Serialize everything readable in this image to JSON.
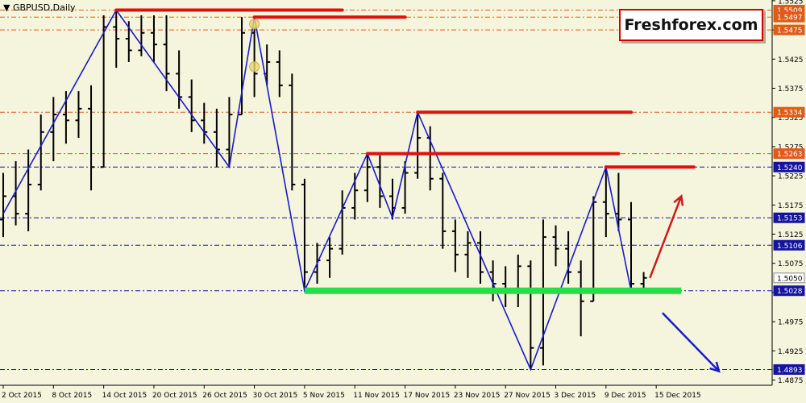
{
  "header": {
    "title": "GBPUSD,Daily",
    "title_arrow": "▼"
  },
  "brand": {
    "label": "Freshforex.com"
  },
  "colors": {
    "background": "#f5f4dc",
    "bars": "#000000",
    "zigzag": "#1a1acc",
    "resistance": "#e01010",
    "support": "#22e04a",
    "level_line": "#1010aa",
    "red_tag": "#e05a18",
    "blue_tag": "#1414a0",
    "white_tag": "#ffffff",
    "up_arrow": "#cc1a1a",
    "down_arrow": "#1a1acc"
  },
  "chart_data": {
    "type": "ohlc",
    "symbol": "GBPUSD",
    "timeframe": "Daily",
    "title": "GBPUSD,Daily",
    "ylim": [
      1.4866,
      1.5518
    ],
    "y_ticks": [
      "1.5525",
      "1.5475",
      "1.5425",
      "1.5375",
      "1.5325",
      "1.5275",
      "1.5225",
      "1.5175",
      "1.5125",
      "1.5075",
      "1.5025",
      "1.4975",
      "1.4925",
      "1.4875"
    ],
    "x_ticks": [
      {
        "label": "2 Oct 2015",
        "index": 0
      },
      {
        "label": "8 Oct 2015",
        "index": 4
      },
      {
        "label": "14 Oct 2015",
        "index": 8
      },
      {
        "label": "20 Oct 2015",
        "index": 12
      },
      {
        "label": "26 Oct 2015",
        "index": 16
      },
      {
        "label": "30 Oct 2015",
        "index": 20
      },
      {
        "label": "5 Nov 2015",
        "index": 24
      },
      {
        "label": "11 Nov 2015",
        "index": 28
      },
      {
        "label": "17 Nov 2015",
        "index": 32
      },
      {
        "label": "23 Nov 2015",
        "index": 36
      },
      {
        "label": "27 Nov 2015",
        "index": 40
      },
      {
        "label": "3 Dec 2015",
        "index": 44
      },
      {
        "label": "9 Dec 2015",
        "index": 48
      },
      {
        "label": "15 Dec 2015",
        "index": 52
      }
    ],
    "bars": [
      {
        "i": 0,
        "o": 1.515,
        "h": 1.523,
        "l": 1.512,
        "c": 1.519
      },
      {
        "i": 1,
        "o": 1.519,
        "h": 1.525,
        "l": 1.514,
        "c": 1.516
      },
      {
        "i": 2,
        "o": 1.516,
        "h": 1.527,
        "l": 1.513,
        "c": 1.521
      },
      {
        "i": 3,
        "o": 1.521,
        "h": 1.533,
        "l": 1.52,
        "c": 1.53
      },
      {
        "i": 4,
        "o": 1.53,
        "h": 1.536,
        "l": 1.525,
        "c": 1.533
      },
      {
        "i": 5,
        "o": 1.533,
        "h": 1.537,
        "l": 1.528,
        "c": 1.532
      },
      {
        "i": 6,
        "o": 1.532,
        "h": 1.537,
        "l": 1.529,
        "c": 1.534
      },
      {
        "i": 7,
        "o": 1.534,
        "h": 1.538,
        "l": 1.52,
        "c": 1.524
      },
      {
        "i": 8,
        "o": 1.524,
        "h": 1.55,
        "l": 1.524,
        "c": 1.548
      },
      {
        "i": 9,
        "o": 1.548,
        "h": 1.5509,
        "l": 1.541,
        "c": 1.546
      },
      {
        "i": 10,
        "o": 1.546,
        "h": 1.549,
        "l": 1.542,
        "c": 1.544
      },
      {
        "i": 11,
        "o": 1.544,
        "h": 1.55,
        "l": 1.543,
        "c": 1.547
      },
      {
        "i": 12,
        "o": 1.547,
        "h": 1.55,
        "l": 1.542,
        "c": 1.545
      },
      {
        "i": 13,
        "o": 1.545,
        "h": 1.55,
        "l": 1.537,
        "c": 1.54
      },
      {
        "i": 14,
        "o": 1.54,
        "h": 1.544,
        "l": 1.534,
        "c": 1.536
      },
      {
        "i": 15,
        "o": 1.536,
        "h": 1.539,
        "l": 1.53,
        "c": 1.532
      },
      {
        "i": 16,
        "o": 1.532,
        "h": 1.535,
        "l": 1.528,
        "c": 1.53
      },
      {
        "i": 17,
        "o": 1.53,
        "h": 1.534,
        "l": 1.524,
        "c": 1.527
      },
      {
        "i": 18,
        "o": 1.527,
        "h": 1.536,
        "l": 1.524,
        "c": 1.533
      },
      {
        "i": 19,
        "o": 1.533,
        "h": 1.5497,
        "l": 1.533,
        "c": 1.547
      },
      {
        "i": 20,
        "o": 1.547,
        "h": 1.548,
        "l": 1.536,
        "c": 1.54
      },
      {
        "i": 21,
        "o": 1.54,
        "h": 1.545,
        "l": 1.538,
        "c": 1.542
      },
      {
        "i": 22,
        "o": 1.542,
        "h": 1.544,
        "l": 1.536,
        "c": 1.538
      },
      {
        "i": 23,
        "o": 1.538,
        "h": 1.54,
        "l": 1.52,
        "c": 1.521
      },
      {
        "i": 24,
        "o": 1.521,
        "h": 1.522,
        "l": 1.5028,
        "c": 1.506
      },
      {
        "i": 25,
        "o": 1.506,
        "h": 1.511,
        "l": 1.504,
        "c": 1.508
      },
      {
        "i": 26,
        "o": 1.508,
        "h": 1.512,
        "l": 1.505,
        "c": 1.51
      },
      {
        "i": 27,
        "o": 1.51,
        "h": 1.52,
        "l": 1.509,
        "c": 1.517
      },
      {
        "i": 28,
        "o": 1.517,
        "h": 1.523,
        "l": 1.515,
        "c": 1.52
      },
      {
        "i": 29,
        "o": 1.52,
        "h": 1.5263,
        "l": 1.518,
        "c": 1.524
      },
      {
        "i": 30,
        "o": 1.524,
        "h": 1.526,
        "l": 1.517,
        "c": 1.519
      },
      {
        "i": 31,
        "o": 1.519,
        "h": 1.522,
        "l": 1.515,
        "c": 1.517
      },
      {
        "i": 32,
        "o": 1.517,
        "h": 1.525,
        "l": 1.516,
        "c": 1.523
      },
      {
        "i": 33,
        "o": 1.523,
        "h": 1.5334,
        "l": 1.522,
        "c": 1.529
      },
      {
        "i": 34,
        "o": 1.529,
        "h": 1.531,
        "l": 1.52,
        "c": 1.522
      },
      {
        "i": 35,
        "o": 1.522,
        "h": 1.523,
        "l": 1.51,
        "c": 1.513
      },
      {
        "i": 36,
        "o": 1.513,
        "h": 1.515,
        "l": 1.506,
        "c": 1.509
      },
      {
        "i": 37,
        "o": 1.509,
        "h": 1.513,
        "l": 1.505,
        "c": 1.511
      },
      {
        "i": 38,
        "o": 1.511,
        "h": 1.513,
        "l": 1.504,
        "c": 1.506
      },
      {
        "i": 39,
        "o": 1.506,
        "h": 1.508,
        "l": 1.501,
        "c": 1.504
      },
      {
        "i": 40,
        "o": 1.504,
        "h": 1.507,
        "l": 1.5,
        "c": 1.503
      },
      {
        "i": 41,
        "o": 1.503,
        "h": 1.509,
        "l": 1.5,
        "c": 1.507
      },
      {
        "i": 42,
        "o": 1.507,
        "h": 1.508,
        "l": 1.4893,
        "c": 1.493
      },
      {
        "i": 43,
        "o": 1.493,
        "h": 1.515,
        "l": 1.49,
        "c": 1.512
      },
      {
        "i": 44,
        "o": 1.512,
        "h": 1.514,
        "l": 1.507,
        "c": 1.51
      },
      {
        "i": 45,
        "o": 1.51,
        "h": 1.513,
        "l": 1.504,
        "c": 1.506
      },
      {
        "i": 46,
        "o": 1.506,
        "h": 1.508,
        "l": 1.495,
        "c": 1.501
      },
      {
        "i": 47,
        "o": 1.501,
        "h": 1.519,
        "l": 1.501,
        "c": 1.518
      },
      {
        "i": 48,
        "o": 1.518,
        "h": 1.524,
        "l": 1.512,
        "c": 1.516
      },
      {
        "i": 49,
        "o": 1.516,
        "h": 1.523,
        "l": 1.513,
        "c": 1.515
      },
      {
        "i": 50,
        "o": 1.515,
        "h": 1.518,
        "l": 1.503,
        "c": 1.504
      },
      {
        "i": 51,
        "o": 1.504,
        "h": 1.506,
        "l": 1.503,
        "c": 1.505
      }
    ],
    "zigzag": [
      {
        "i": 0,
        "p": 1.516
      },
      {
        "i": 9,
        "p": 1.5509
      },
      {
        "i": 18,
        "p": 1.524
      },
      {
        "i": 20,
        "p": 1.5497
      },
      {
        "i": 24,
        "p": 1.5028
      },
      {
        "i": 29,
        "p": 1.5263
      },
      {
        "i": 31,
        "p": 1.5153
      },
      {
        "i": 33,
        "p": 1.5334
      },
      {
        "i": 42,
        "p": 1.4893
      },
      {
        "i": 48,
        "p": 1.524
      },
      {
        "i": 50,
        "p": 1.5028
      }
    ],
    "resistance_lines": [
      {
        "price": 1.5509,
        "from": 9,
        "to": 27
      },
      {
        "price": 1.5497,
        "from": 20,
        "to": 32
      },
      {
        "price": 1.5334,
        "from": 33,
        "to": 50
      },
      {
        "price": 1.5263,
        "from": 29,
        "to": 49
      },
      {
        "price": 1.524,
        "from": 48,
        "to": 55
      }
    ],
    "support_lines": [
      {
        "price": 1.5028,
        "from": 24,
        "to": 54
      }
    ],
    "level_lines": [
      {
        "price": 1.5509,
        "color": "#e05a18"
      },
      {
        "price": 1.5497,
        "color": "#e05a18"
      },
      {
        "price": 1.5475,
        "color": "#e05a18"
      },
      {
        "price": 1.5334,
        "color": "#e05a18"
      },
      {
        "price": 1.5263,
        "color": "#e05a18"
      },
      {
        "price": 1.524,
        "color": "#1414a0"
      },
      {
        "price": 1.5153,
        "color": "#1414a0"
      },
      {
        "price": 1.5106,
        "color": "#1414a0"
      },
      {
        "price": 1.5028,
        "color": "#1414a0"
      },
      {
        "price": 1.4893,
        "color": "#1414a0"
      }
    ],
    "price_tags": [
      {
        "label": "1.5509",
        "price": 1.5509,
        "style": "red"
      },
      {
        "label": "1.5497",
        "price": 1.5497,
        "style": "red"
      },
      {
        "label": "1.5475",
        "price": 1.5475,
        "style": "red"
      },
      {
        "label": "1.5334",
        "price": 1.5334,
        "style": "red"
      },
      {
        "label": "1.5263",
        "price": 1.5263,
        "style": "red"
      },
      {
        "label": "1.5240",
        "price": 1.524,
        "style": "blue"
      },
      {
        "label": "1.5153",
        "price": 1.5153,
        "style": "blue"
      },
      {
        "label": "1.5106",
        "price": 1.5106,
        "style": "blue"
      },
      {
        "label": "1.5050",
        "price": 1.505,
        "style": "white"
      },
      {
        "label": "1.5028",
        "price": 1.5028,
        "style": "blue"
      },
      {
        "label": "1.4893",
        "price": 1.4893,
        "style": "blue"
      }
    ],
    "arrows": [
      {
        "name": "up",
        "from": {
          "i": 51.5,
          "p": 1.505
        },
        "to": {
          "i": 54,
          "p": 1.519
        }
      },
      {
        "name": "down",
        "from": {
          "i": 52.5,
          "p": 1.499
        },
        "to": {
          "i": 57,
          "p": 1.489
        }
      }
    ],
    "markers": [
      {
        "i": 20,
        "p": 1.5485
      },
      {
        "i": 20,
        "p": 1.5412
      }
    ]
  }
}
